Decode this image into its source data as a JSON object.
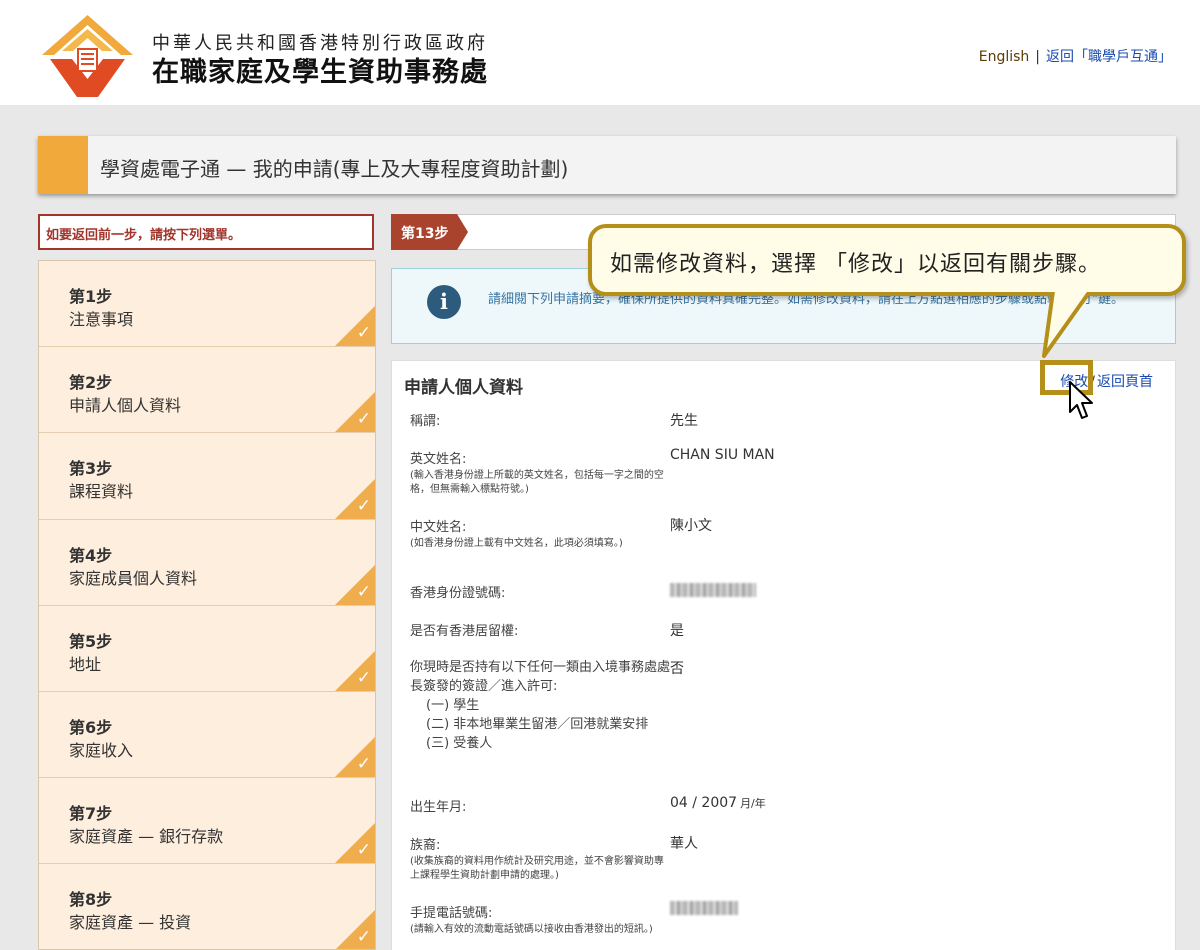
{
  "header": {
    "gov_line1": "中華人民共和國香港特別行政區政府",
    "gov_line2": "在職家庭及學生資助事務處",
    "lang_link": "English",
    "back_link": "返回「職學戶互通」"
  },
  "title": "學資處電子通 — 我的申請(專上及大專程度資助計劃)",
  "sidebar": {
    "back_note": "如要返回前一步，請按下列選單。",
    "steps": [
      {
        "num": "第1步",
        "name": "注意事項"
      },
      {
        "num": "第2步",
        "name": "申請人個人資料"
      },
      {
        "num": "第3步",
        "name": "課程資料"
      },
      {
        "num": "第4步",
        "name": "家庭成員個人資料"
      },
      {
        "num": "第5步",
        "name": "地址"
      },
      {
        "num": "第6步",
        "name": "家庭收入"
      },
      {
        "num": "第7步",
        "name": "家庭資產 — 銀行存款"
      },
      {
        "num": "第8步",
        "name": "家庭資產 — 投資"
      }
    ]
  },
  "current_step": "第13步",
  "info_text": "請細閱下列申請摘要，確保所提供的資料真確完整。如需修改資料，請在上方點選相應的步驟或點擊\"修訂\"鍵。",
  "callout": "如需修改資料，選擇 「修改」以返回有關步驟。",
  "section": {
    "title": "申請人個人資料",
    "edit_link": "修改",
    "separator": "/",
    "home_link": "返回頁首"
  },
  "fields": {
    "title_label": "稱謂:",
    "title_value": "先生",
    "en_name_label": "英文姓名:",
    "en_name_note": "(輸入香港身份證上所載的英文姓名，包括每一字之間的空格，但無需輸入標點符號。)",
    "en_name_value": "CHAN SIU MAN",
    "cn_name_label": "中文姓名:",
    "cn_name_note": "(如香港身份證上載有中文姓名，此項必須填寫。)",
    "cn_name_value": "陳小文",
    "hkid_label": "香港身份證號碼:",
    "residence_label": "是否有香港居留權:",
    "residence_value": "是",
    "permit_q": "你現時是否持有以下任何一類由入境事務處處長簽發的簽證／進入許可:",
    "permit_opt1": "(一) 學生",
    "permit_opt2": "(二) 非本地畢業生留港／回港就業安排",
    "permit_opt3": "(三) 受養人",
    "permit_value": "否",
    "dob_label": "出生年月:",
    "dob_value": "04 / 2007",
    "dob_unit": "月/年",
    "race_label": "族裔:",
    "race_note": "(收集族裔的資料用作統計及研究用途，並不會影響資助專上課程學生資助計劃申請的處理。)",
    "race_value": "華人",
    "mobile_label": "手提電話號碼:",
    "mobile_note": "(請輸入有效的流動電話號碼以接收由香港發出的短訊。)"
  },
  "colors": {
    "accent": "#f0a93a",
    "step_bg": "#fdeedd",
    "ribbon": "#a9432d",
    "link": "#1a4bb0",
    "callout_border": "#b4901a"
  }
}
